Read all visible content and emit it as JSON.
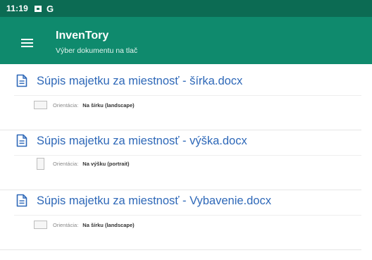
{
  "status_bar": {
    "time": "11:19",
    "icons": [
      "notification-box-icon",
      "google-g-icon"
    ],
    "g_label": "G"
  },
  "app_bar": {
    "title": "InvenTory",
    "subtitle": "Výber dokumentu na tlač",
    "menu_icon": "hamburger-menu-icon"
  },
  "documents": [
    {
      "name": "Súpis majetku za miestnosť - šírka.docx",
      "orientation_label": "Orientácia:",
      "orientation_value": "Na šírku (landscape)",
      "orientation": "landscape"
    },
    {
      "name": "Súpis majetku za miestnosť - výška.docx",
      "orientation_label": "Orientácia:",
      "orientation_value": "Na výšku (portrait)",
      "orientation": "portrait"
    },
    {
      "name": "Súpis majetku za miestnosť - Vybavenie.docx",
      "orientation_label": "Orientácia:",
      "orientation_value": "Na šírku (landscape)",
      "orientation": "landscape"
    }
  ],
  "colors": {
    "status_bar": "#0c6b53",
    "app_bar": "#0f8a6d",
    "link": "#2e68b8"
  }
}
